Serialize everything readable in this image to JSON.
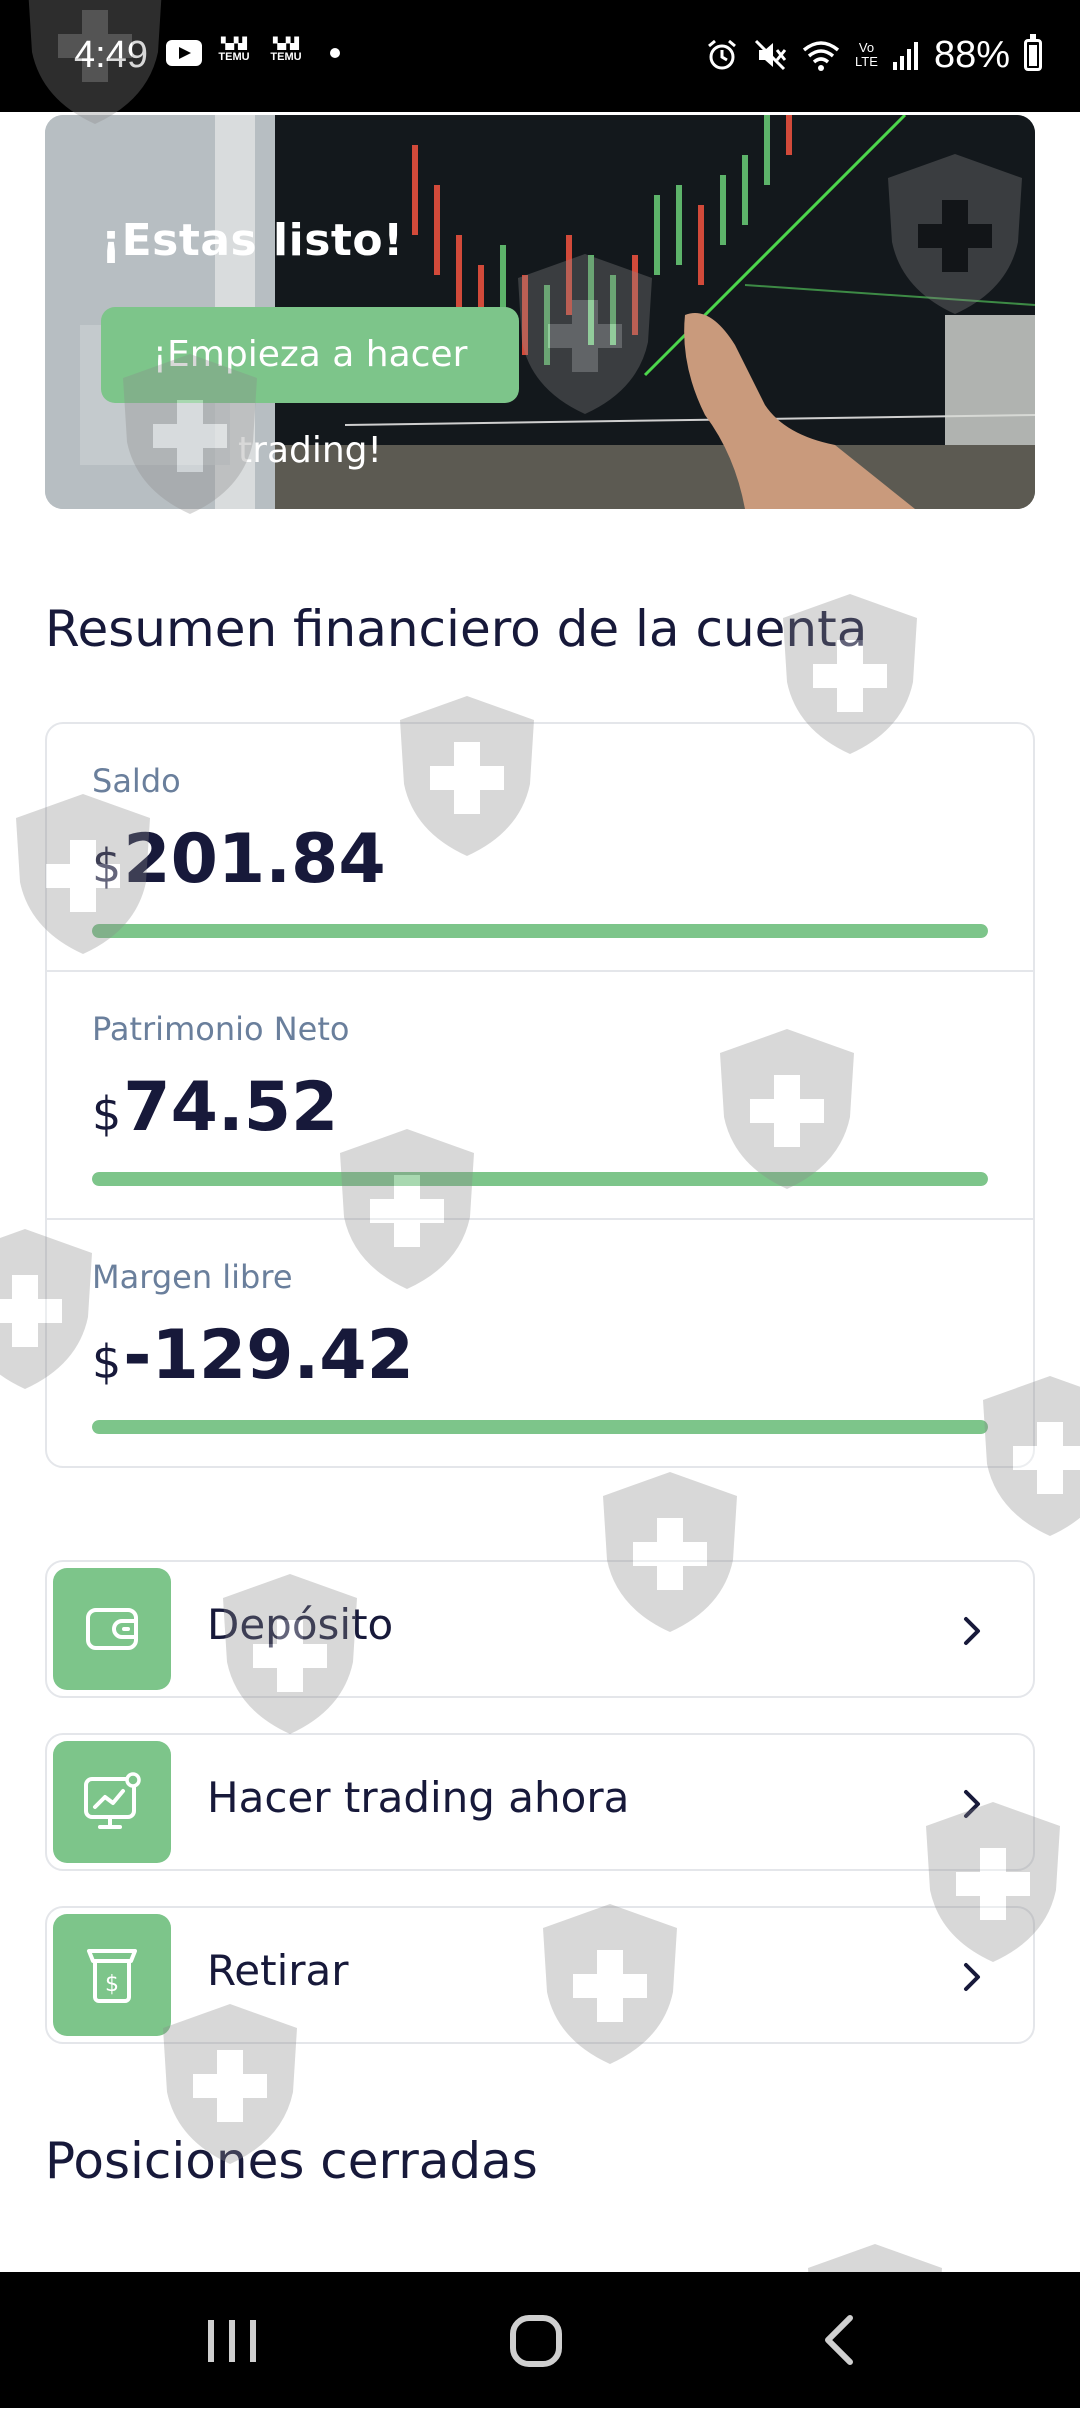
{
  "status_bar": {
    "time": "4:49",
    "notification_icons": [
      "youtube-icon",
      "temu-icon",
      "temu-icon",
      "dot-icon"
    ],
    "temu_label": "TEMU",
    "battery": "88%",
    "lte_label": "LTE",
    "volte_label": "Vo"
  },
  "banner": {
    "title": "¡Estas listo!",
    "button_label": "¡Empieza a hacer trading!"
  },
  "summary": {
    "title": "Resumen financiero de la cuenta",
    "metrics": [
      {
        "label": "Saldo",
        "currency": "$",
        "value": "201.84",
        "progress": 1.0
      },
      {
        "label": "Patrimonio Neto",
        "currency": "$",
        "value": "74.52",
        "progress": 1.0
      },
      {
        "label": "Margen libre",
        "currency": "$",
        "value": "-129.42",
        "progress": 1.0
      }
    ]
  },
  "actions": [
    {
      "label": "Depósito",
      "icon": "wallet-icon"
    },
    {
      "label": "Hacer trading ahora",
      "icon": "trading-chart-icon"
    },
    {
      "label": "Retirar",
      "icon": "withdraw-icon"
    }
  ],
  "closed_positions": {
    "title": "Posiciones cerradas"
  },
  "nav": {
    "items": [
      "recent-apps-icon",
      "home-icon",
      "back-icon"
    ]
  },
  "colors": {
    "accent_green": "#7dc58a",
    "text_dark": "#17193a",
    "label_gray": "#6a7f9c",
    "border": "#e4e6ea"
  }
}
